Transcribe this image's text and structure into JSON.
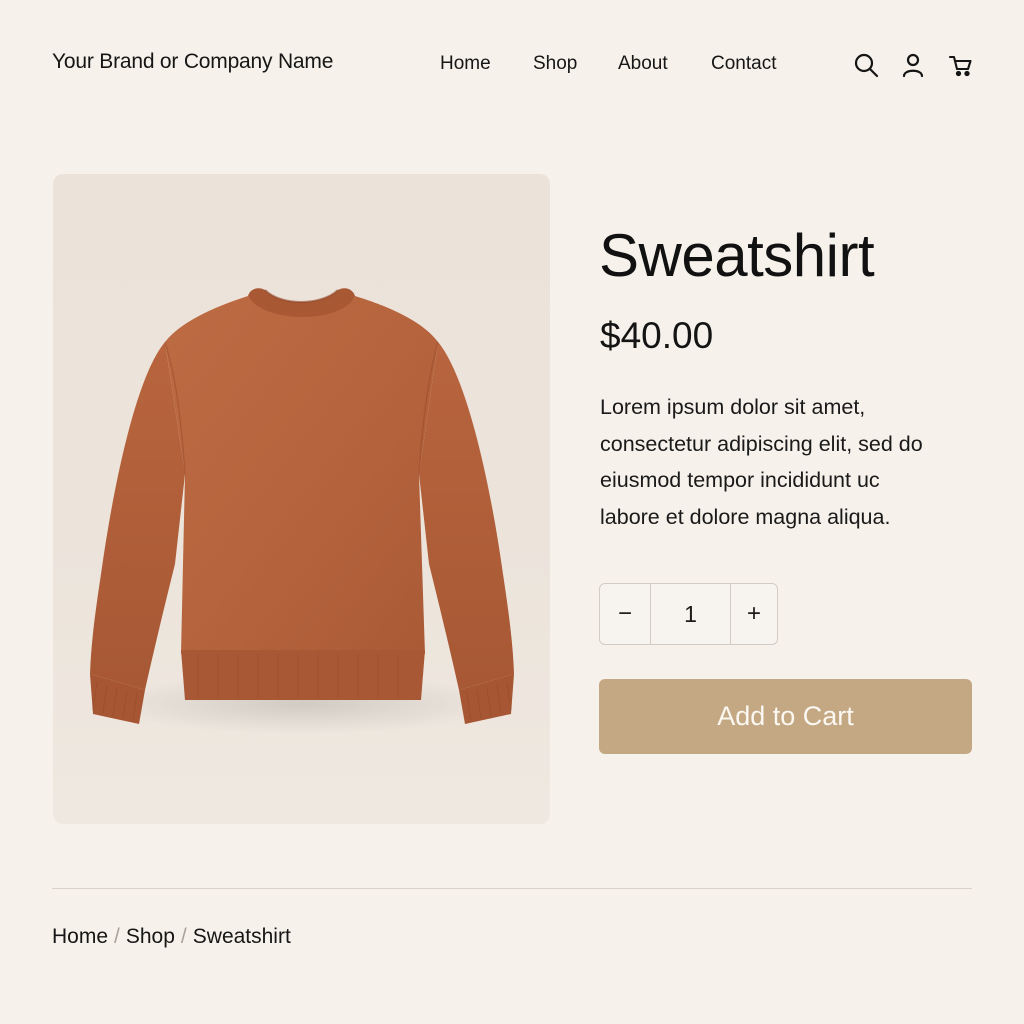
{
  "header": {
    "brand": "Your Brand or Company Name",
    "nav": [
      "Home",
      "Shop",
      "About",
      "Contact"
    ],
    "icons": [
      "search-icon",
      "user-icon",
      "cart-icon"
    ]
  },
  "product": {
    "title": "Sweatshirt",
    "price": "$40.00",
    "description_lines": [
      "Lorem ipsum dolor sit amet,",
      "consectetur adipiscing elit, sed do",
      "eiusmod tempor incididunt uc",
      "labore et dolore magna aliqua."
    ],
    "quantity": {
      "decrement": "−",
      "value": "1",
      "increment": "+"
    },
    "add_to_cart": "Add to Cart",
    "image_color": "#b8663f"
  },
  "breadcrumb": {
    "items": [
      "Home",
      "Shop",
      "Sweatshirt"
    ],
    "separator": "/"
  },
  "colors": {
    "background": "#f6f1ea",
    "image_panel": "#ece4db",
    "button": "#c4a884",
    "button_text": "#fbf7f1"
  }
}
